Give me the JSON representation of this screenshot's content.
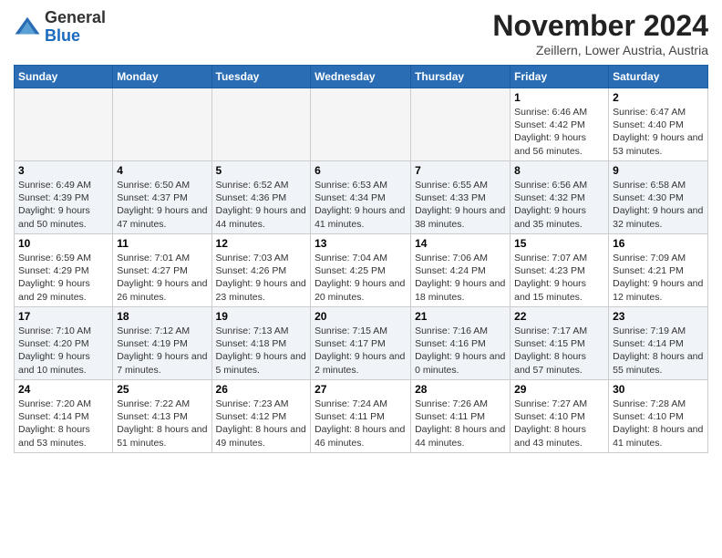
{
  "logo": {
    "general": "General",
    "blue": "Blue"
  },
  "header": {
    "month_title": "November 2024",
    "subtitle": "Zeillern, Lower Austria, Austria"
  },
  "days_of_week": [
    "Sunday",
    "Monday",
    "Tuesday",
    "Wednesday",
    "Thursday",
    "Friday",
    "Saturday"
  ],
  "weeks": [
    [
      {
        "day": "",
        "info": "",
        "empty": true
      },
      {
        "day": "",
        "info": "",
        "empty": true
      },
      {
        "day": "",
        "info": "",
        "empty": true
      },
      {
        "day": "",
        "info": "",
        "empty": true
      },
      {
        "day": "",
        "info": "",
        "empty": true
      },
      {
        "day": "1",
        "info": "Sunrise: 6:46 AM\nSunset: 4:42 PM\nDaylight: 9 hours and 56 minutes."
      },
      {
        "day": "2",
        "info": "Sunrise: 6:47 AM\nSunset: 4:40 PM\nDaylight: 9 hours and 53 minutes."
      }
    ],
    [
      {
        "day": "3",
        "info": "Sunrise: 6:49 AM\nSunset: 4:39 PM\nDaylight: 9 hours and 50 minutes."
      },
      {
        "day": "4",
        "info": "Sunrise: 6:50 AM\nSunset: 4:37 PM\nDaylight: 9 hours and 47 minutes."
      },
      {
        "day": "5",
        "info": "Sunrise: 6:52 AM\nSunset: 4:36 PM\nDaylight: 9 hours and 44 minutes."
      },
      {
        "day": "6",
        "info": "Sunrise: 6:53 AM\nSunset: 4:34 PM\nDaylight: 9 hours and 41 minutes."
      },
      {
        "day": "7",
        "info": "Sunrise: 6:55 AM\nSunset: 4:33 PM\nDaylight: 9 hours and 38 minutes."
      },
      {
        "day": "8",
        "info": "Sunrise: 6:56 AM\nSunset: 4:32 PM\nDaylight: 9 hours and 35 minutes."
      },
      {
        "day": "9",
        "info": "Sunrise: 6:58 AM\nSunset: 4:30 PM\nDaylight: 9 hours and 32 minutes."
      }
    ],
    [
      {
        "day": "10",
        "info": "Sunrise: 6:59 AM\nSunset: 4:29 PM\nDaylight: 9 hours and 29 minutes."
      },
      {
        "day": "11",
        "info": "Sunrise: 7:01 AM\nSunset: 4:27 PM\nDaylight: 9 hours and 26 minutes."
      },
      {
        "day": "12",
        "info": "Sunrise: 7:03 AM\nSunset: 4:26 PM\nDaylight: 9 hours and 23 minutes."
      },
      {
        "day": "13",
        "info": "Sunrise: 7:04 AM\nSunset: 4:25 PM\nDaylight: 9 hours and 20 minutes."
      },
      {
        "day": "14",
        "info": "Sunrise: 7:06 AM\nSunset: 4:24 PM\nDaylight: 9 hours and 18 minutes."
      },
      {
        "day": "15",
        "info": "Sunrise: 7:07 AM\nSunset: 4:23 PM\nDaylight: 9 hours and 15 minutes."
      },
      {
        "day": "16",
        "info": "Sunrise: 7:09 AM\nSunset: 4:21 PM\nDaylight: 9 hours and 12 minutes."
      }
    ],
    [
      {
        "day": "17",
        "info": "Sunrise: 7:10 AM\nSunset: 4:20 PM\nDaylight: 9 hours and 10 minutes."
      },
      {
        "day": "18",
        "info": "Sunrise: 7:12 AM\nSunset: 4:19 PM\nDaylight: 9 hours and 7 minutes."
      },
      {
        "day": "19",
        "info": "Sunrise: 7:13 AM\nSunset: 4:18 PM\nDaylight: 9 hours and 5 minutes."
      },
      {
        "day": "20",
        "info": "Sunrise: 7:15 AM\nSunset: 4:17 PM\nDaylight: 9 hours and 2 minutes."
      },
      {
        "day": "21",
        "info": "Sunrise: 7:16 AM\nSunset: 4:16 PM\nDaylight: 9 hours and 0 minutes."
      },
      {
        "day": "22",
        "info": "Sunrise: 7:17 AM\nSunset: 4:15 PM\nDaylight: 8 hours and 57 minutes."
      },
      {
        "day": "23",
        "info": "Sunrise: 7:19 AM\nSunset: 4:14 PM\nDaylight: 8 hours and 55 minutes."
      }
    ],
    [
      {
        "day": "24",
        "info": "Sunrise: 7:20 AM\nSunset: 4:14 PM\nDaylight: 8 hours and 53 minutes."
      },
      {
        "day": "25",
        "info": "Sunrise: 7:22 AM\nSunset: 4:13 PM\nDaylight: 8 hours and 51 minutes."
      },
      {
        "day": "26",
        "info": "Sunrise: 7:23 AM\nSunset: 4:12 PM\nDaylight: 8 hours and 49 minutes."
      },
      {
        "day": "27",
        "info": "Sunrise: 7:24 AM\nSunset: 4:11 PM\nDaylight: 8 hours and 46 minutes."
      },
      {
        "day": "28",
        "info": "Sunrise: 7:26 AM\nSunset: 4:11 PM\nDaylight: 8 hours and 44 minutes."
      },
      {
        "day": "29",
        "info": "Sunrise: 7:27 AM\nSunset: 4:10 PM\nDaylight: 8 hours and 43 minutes."
      },
      {
        "day": "30",
        "info": "Sunrise: 7:28 AM\nSunset: 4:10 PM\nDaylight: 8 hours and 41 minutes."
      }
    ]
  ]
}
